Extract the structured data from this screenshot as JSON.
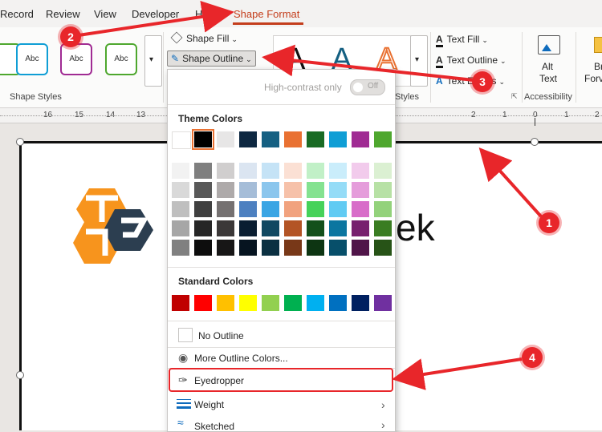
{
  "tabs": [
    "Record",
    "Review",
    "View",
    "Developer",
    "Help",
    "Shape Format"
  ],
  "ribbon": {
    "shape_styles": [
      "Abc",
      "Abc",
      "Abc"
    ],
    "shape_styles_label": "Shape Styles",
    "shape_fill": "Shape Fill",
    "shape_outline": "Shape Outline",
    "wordart_letters": [
      "A",
      "A",
      "A"
    ],
    "text_fill": "Text Fill",
    "text_outline": "Text Outline",
    "text_effects": "Text Effects",
    "wordart_label_tail": "Styles",
    "alt_text_1": "Alt",
    "alt_text_2": "Text",
    "accessibility_label": "Accessibility",
    "bring_1": "Br",
    "bring_2": "Forv"
  },
  "ruler_ticks": [
    "16",
    "15",
    "14",
    "13",
    "2",
    "1",
    "0",
    "1",
    "2"
  ],
  "slide": {
    "logo_text_tail": "ek"
  },
  "menu": {
    "high_contrast_label": "High-contrast only",
    "high_contrast_toggle": "Off",
    "theme_colors_label": "Theme Colors",
    "theme_top": [
      "#ffffff",
      "#000000",
      "#e7e6e6",
      "#0e2841",
      "#156082",
      "#e97132",
      "#196b24",
      "#0f9ed5",
      "#a02b93",
      "#4ea72e"
    ],
    "theme_shades": [
      [
        "#f2f2f2",
        "#7f7f7f",
        "#d0cece",
        "#dbe5f1",
        "#c5e3f6",
        "#fbe0d4",
        "#c1f0c7",
        "#caedfb",
        "#f2cbec",
        "#dbf0d2"
      ],
      [
        "#d9d9d9",
        "#595959",
        "#aeaaaa",
        "#a5bdd8",
        "#8bc6ed",
        "#f6c1a9",
        "#84e290",
        "#95dcf7",
        "#e59ddb",
        "#b7e1a5"
      ],
      [
        "#bfbfbf",
        "#404040",
        "#757171",
        "#4d80c0",
        "#3aa5e4",
        "#f1a27e",
        "#46d25a",
        "#61cbf3",
        "#d86dc9",
        "#93d27b"
      ],
      [
        "#a6a6a6",
        "#262626",
        "#3b3838",
        "#0a1e31",
        "#104861",
        "#b35425",
        "#13501b",
        "#0b76a0",
        "#77206e",
        "#3a7d22"
      ],
      [
        "#808080",
        "#0d0d0d",
        "#171616",
        "#061420",
        "#0b3041",
        "#783818",
        "#0d3512",
        "#074f6a",
        "#501549",
        "#275317"
      ]
    ],
    "standard_colors_label": "Standard Colors",
    "standard_colors": [
      "#c00000",
      "#ff0000",
      "#ffc000",
      "#ffff00",
      "#92d050",
      "#00b050",
      "#00b0f0",
      "#0070c0",
      "#002060",
      "#7030a0"
    ],
    "no_outline": "No Outline",
    "more_colors": "More Outline Colors...",
    "eyedropper": "Eyedropper",
    "weight": "Weight",
    "sketched": "Sketched"
  },
  "callouts": [
    "1",
    "2",
    "3",
    "4"
  ]
}
